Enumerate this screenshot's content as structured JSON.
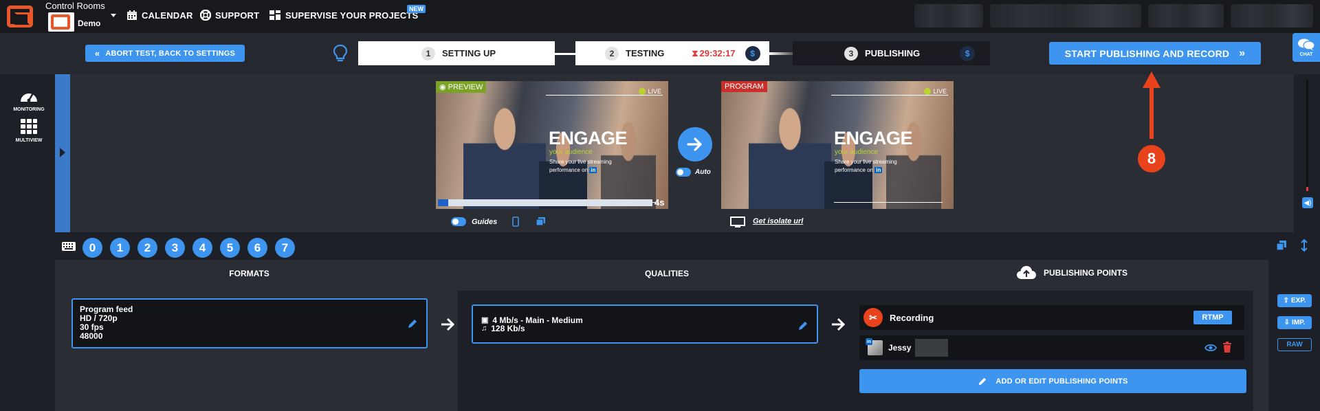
{
  "app": {
    "name": "Control Rooms",
    "workspace": "Demo"
  },
  "nav": {
    "calendar": "CALENDAR",
    "support": "SUPPORT",
    "supervise": "SUPERVISE YOUR PROJECTS",
    "new_badge": "NEW"
  },
  "toolbar": {
    "abort_label": "ABORT TEST, BACK TO SETTINGS",
    "start_label": "START PUBLISHING AND RECORD",
    "chat_label": "CHAT"
  },
  "steps": [
    {
      "num": "1",
      "label": "SETTING UP"
    },
    {
      "num": "2",
      "label": "TESTING",
      "timer": "29:32:17"
    },
    {
      "num": "3",
      "label": "PUBLISHING"
    }
  ],
  "currency_symbol": "$",
  "left_rail": {
    "monitoring": "MONITORING",
    "multiview": "MULTIVIEW"
  },
  "preview": {
    "tag": "PREVIEW",
    "live": "LIVE",
    "headline": "ENGAGE",
    "sub": "your audience",
    "body": "Share your live streaming performance on",
    "brand_badge": "in",
    "countdown": "4s",
    "guides": "Guides",
    "auto": "Auto"
  },
  "program": {
    "tag": "PROGRAM",
    "live": "LIVE",
    "headline": "ENGAGE",
    "sub": "your audience",
    "body": "Share your live streaming performance on",
    "brand_badge": "in",
    "isolate_link": "Get isolate url"
  },
  "annotation": {
    "number": "8"
  },
  "scenes": [
    "0",
    "1",
    "2",
    "3",
    "4",
    "5",
    "6",
    "7"
  ],
  "columns": {
    "formats": "FORMATS",
    "qualities": "QUALITIES",
    "publishing": "PUBLISHING POINTS"
  },
  "format_card": {
    "line1": "Program feed",
    "line2": "HD / 720p",
    "line3": "30 fps",
    "line4": "48000"
  },
  "quality_card": {
    "video": "4 Mb/s  -  Main  -  Medium",
    "audio": "128 Kb/s"
  },
  "publishing": {
    "recording": "Recording",
    "rtmp": "RTMP",
    "user": "Jessy",
    "user_badge": "in",
    "add_label": "ADD OR EDIT PUBLISHING POINTS"
  },
  "side": {
    "exp": "EXP.",
    "imp": "IMP.",
    "raw": "RAW"
  },
  "colors": {
    "accent": "#3d95ef",
    "brand": "#e8572a",
    "preview_tag": "#7aa226",
    "program_tag": "#c9302c",
    "timer": "#e03a3a"
  }
}
